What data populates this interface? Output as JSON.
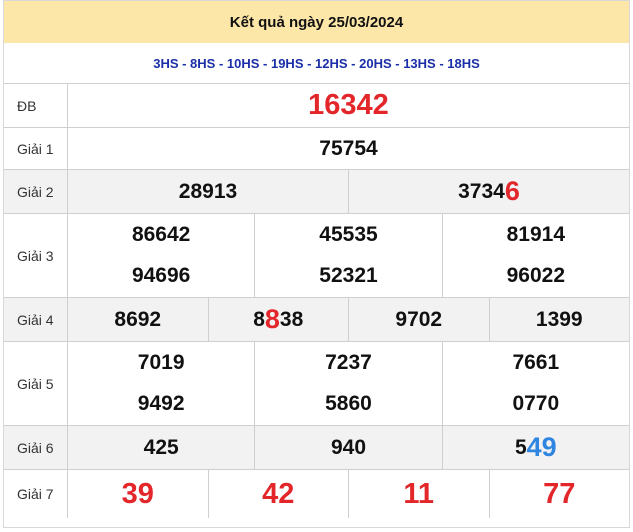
{
  "header": {
    "title": "Kết quả ngày 25/03/2024"
  },
  "codes": "3HS - 8HS - 10HS - 19HS - 12HS - 20HS - 13HS - 18HS",
  "rows": {
    "db": {
      "label": "ĐB",
      "value": "16342"
    },
    "g1": {
      "label": "Giải 1",
      "value": "75754"
    },
    "g2": {
      "label": "Giải 2",
      "values": [
        {
          "main": "28913",
          "tail": ""
        },
        {
          "main": "3734",
          "tail": "6"
        }
      ]
    },
    "g3": {
      "label": "Giải 3",
      "values": [
        "86642",
        "45535",
        "81914",
        "94696",
        "52321",
        "96022"
      ]
    },
    "g4": {
      "label": "Giải 4",
      "values": [
        {
          "main": "8692",
          "tail": "",
          "rest": ""
        },
        {
          "main": "8",
          "tail": "8",
          "rest": "38"
        },
        {
          "main": "9702",
          "tail": "",
          "rest": ""
        },
        {
          "main": "1399",
          "tail": "",
          "rest": ""
        }
      ]
    },
    "g5": {
      "label": "Giải 5",
      "values": [
        "7019",
        "7237",
        "7661",
        "9492",
        "5860",
        "0770"
      ]
    },
    "g6": {
      "label": "Giải 6",
      "values": [
        {
          "main": "425",
          "tail": ""
        },
        {
          "main": "940",
          "tail": ""
        },
        {
          "main": "5",
          "tail": "49"
        }
      ]
    },
    "g7": {
      "label": "Giải 7",
      "values": [
        "39",
        "42",
        "11",
        "77"
      ]
    }
  },
  "colors": {
    "header_bg": "#fde7a8",
    "red": "#e3262a",
    "blue": "#2f86e0",
    "codes": "#1a2fa8"
  }
}
